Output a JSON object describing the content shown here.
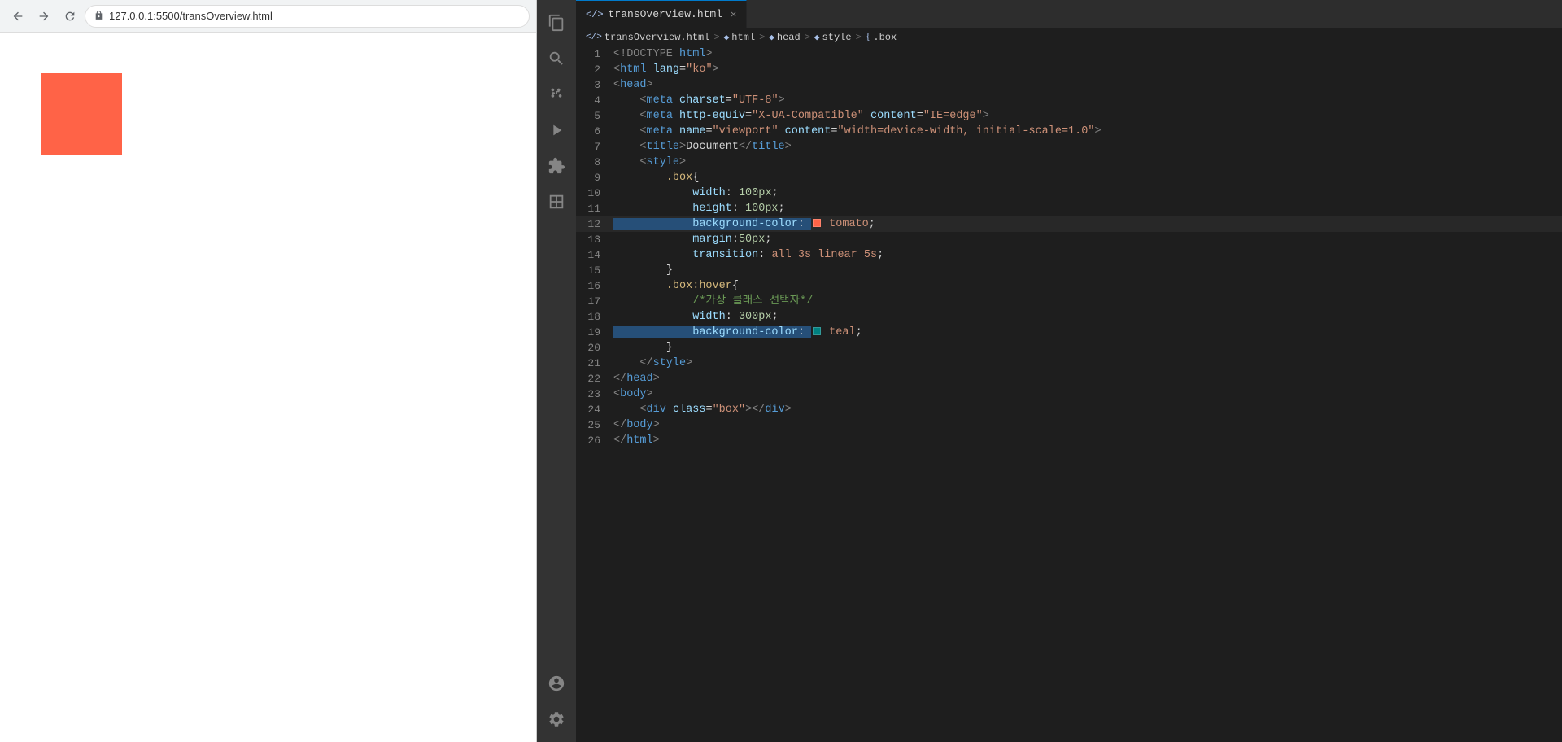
{
  "browser": {
    "url": "127.0.0.1:5500/transOverview.html",
    "back_label": "back",
    "forward_label": "forward",
    "reload_label": "reload"
  },
  "vscode": {
    "tab_label": "transOverview.html",
    "breadcrumb": {
      "file": "transOverview.html",
      "html": "html",
      "head": "head",
      "style": "style",
      "box": ".box"
    },
    "lines": [
      {
        "num": 1,
        "content": "<!DOCTYPE html>"
      },
      {
        "num": 2,
        "content": "<html lang=\"ko\">"
      },
      {
        "num": 3,
        "content": "<head>"
      },
      {
        "num": 4,
        "content": "    <meta charset=\"UTF-8\">"
      },
      {
        "num": 5,
        "content": "    <meta http-equiv=\"X-UA-Compatible\" content=\"IE=edge\">"
      },
      {
        "num": 6,
        "content": "    <meta name=\"viewport\" content=\"width=device-width, initial-scale=1.0\">"
      },
      {
        "num": 7,
        "content": "    <title>Document</title>"
      },
      {
        "num": 8,
        "content": "    <style>"
      },
      {
        "num": 9,
        "content": "        .box{"
      },
      {
        "num": 10,
        "content": "            width: 100px;"
      },
      {
        "num": 11,
        "content": "            height: 100px;"
      },
      {
        "num": 12,
        "content": "            background-color:  tomato;"
      },
      {
        "num": 13,
        "content": "            margin:50px;"
      },
      {
        "num": 14,
        "content": "            transition: all 3s linear 5s;"
      },
      {
        "num": 15,
        "content": "        }"
      },
      {
        "num": 16,
        "content": "        .box:hover{"
      },
      {
        "num": 17,
        "content": "            /*가상 클래스 선택자*/"
      },
      {
        "num": 18,
        "content": "            width: 300px;"
      },
      {
        "num": 19,
        "content": "            background-color:  teal;"
      },
      {
        "num": 20,
        "content": "        }"
      },
      {
        "num": 21,
        "content": "    </style>"
      },
      {
        "num": 22,
        "content": "</head>"
      },
      {
        "num": 23,
        "content": "<body>"
      },
      {
        "num": 24,
        "content": "    <div class=\"box\"></div>"
      },
      {
        "num": 25,
        "content": "</body>"
      },
      {
        "num": 26,
        "content": "</html>"
      }
    ]
  }
}
